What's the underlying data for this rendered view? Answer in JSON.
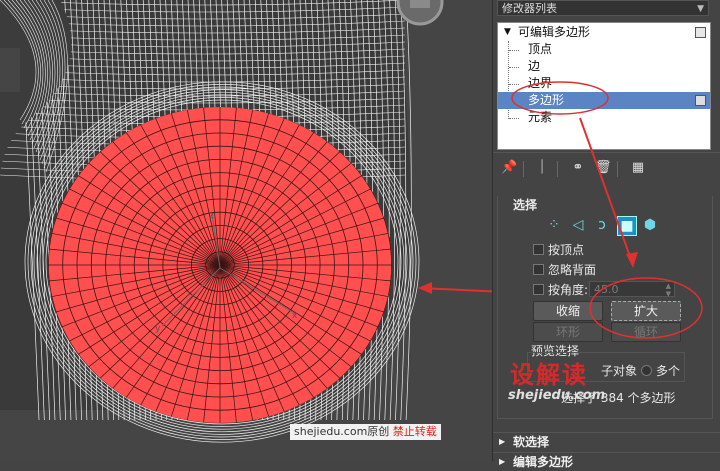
{
  "modifier_list": {
    "label": "修改器列表"
  },
  "stack": {
    "root": "可编辑多边形",
    "items": [
      {
        "label": "顶点"
      },
      {
        "label": "边"
      },
      {
        "label": "边界"
      },
      {
        "label": "多边形",
        "selected": true
      },
      {
        "label": "元素"
      }
    ]
  },
  "toolbar": {
    "icons": [
      "pin-icon",
      "show-end-result-icon",
      "make-unique-icon",
      "remove-modifier-icon",
      "configure-sets-icon"
    ]
  },
  "selection": {
    "title": "选择",
    "subobject_icons": [
      "vertex-icon",
      "edge-icon",
      "border-icon",
      "polygon-icon",
      "element-icon"
    ],
    "by_vertex": "按顶点",
    "ignore_backfacing": "忽略背面",
    "by_angle": "按角度:",
    "angle_value": "45.0",
    "shrink": "收缩",
    "grow": "扩大",
    "ring": "环形",
    "loop": "循环",
    "preview_selection": "预览选择",
    "preview_option_subobj": "子对象",
    "preview_option_multi": "多个",
    "status": "选择了 384 个多边形"
  },
  "soft_selection": {
    "label": "软选择"
  },
  "edit_polygons": {
    "label": "编辑多边形"
  },
  "watermark": {
    "logo": "设解读",
    "url": "shejiedu.com"
  },
  "credit": {
    "site": "shejiedu.com原创",
    "warning": "禁止转载"
  },
  "colors": {
    "selection_red": "#ff4f4f",
    "stack_highlight": "#5b84c4",
    "annotation_red": "#e03030",
    "icon_cyan": "#6fd6e6"
  }
}
